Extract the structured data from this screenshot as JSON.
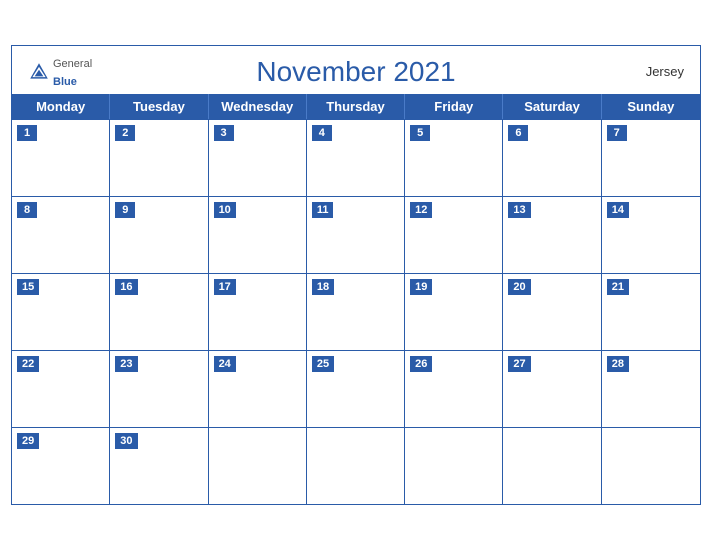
{
  "header": {
    "logo": {
      "general": "General",
      "blue": "Blue"
    },
    "title": "November 2021",
    "region": "Jersey"
  },
  "days": {
    "headers": [
      "Monday",
      "Tuesday",
      "Wednesday",
      "Thursday",
      "Friday",
      "Saturday",
      "Sunday"
    ]
  },
  "weeks": [
    [
      1,
      2,
      3,
      4,
      5,
      6,
      7
    ],
    [
      8,
      9,
      10,
      11,
      12,
      13,
      14
    ],
    [
      15,
      16,
      17,
      18,
      19,
      20,
      21
    ],
    [
      22,
      23,
      24,
      25,
      26,
      27,
      28
    ],
    [
      29,
      30,
      null,
      null,
      null,
      null,
      null
    ]
  ]
}
